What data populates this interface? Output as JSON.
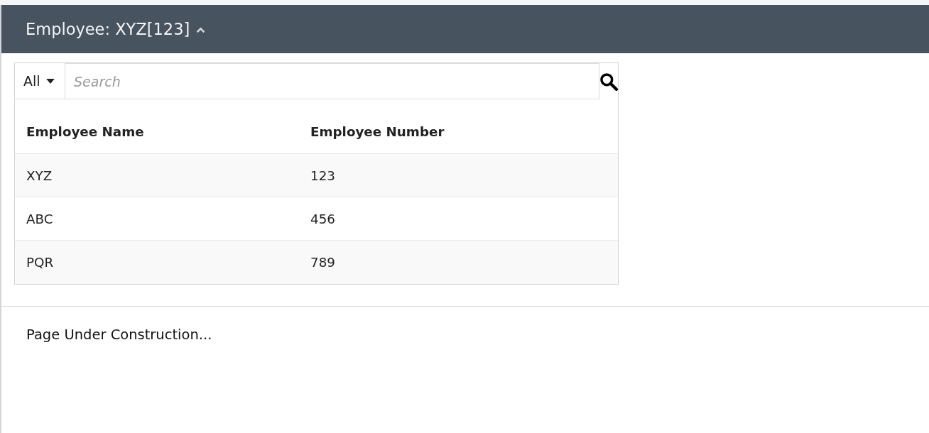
{
  "header": {
    "title": "Employee: XYZ[123]",
    "expanded": true
  },
  "search": {
    "filter": "All",
    "placeholder": "Search"
  },
  "table": {
    "columns": [
      "Employee Name",
      "Employee Number"
    ],
    "rows": [
      [
        "XYZ",
        "123"
      ],
      [
        "ABC",
        "456"
      ],
      [
        "PQR",
        "789"
      ]
    ]
  },
  "notice": "Page Under Construction..."
}
